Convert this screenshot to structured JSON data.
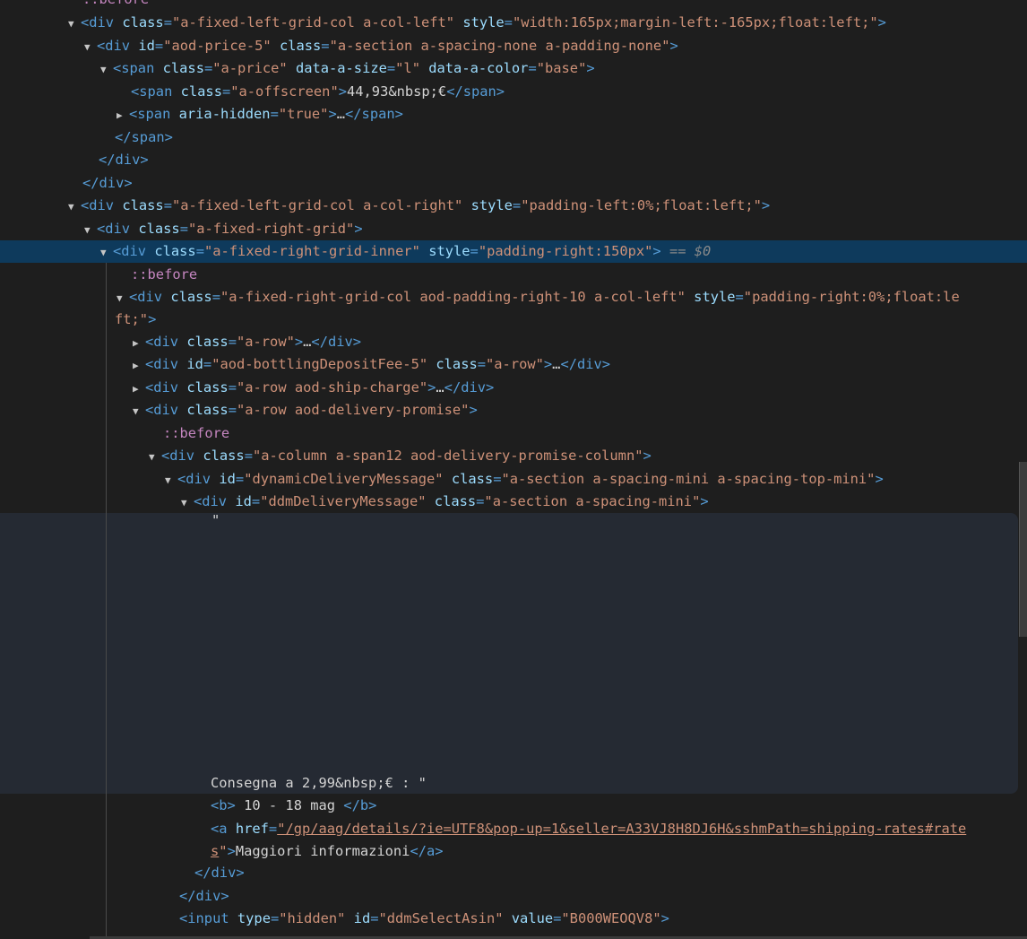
{
  "lines": [
    {
      "pseudo": "::before",
      "text_only": true
    },
    {
      "tag_open": "<div",
      "attrs": [
        {
          "n": "class",
          "v": "\"a-fixed-left-grid-col a-col-left\""
        },
        {
          "n": "style",
          "v": "\"width:165px;margin-left:-165px;float:left;\""
        }
      ],
      "close": ">"
    },
    {
      "tag_open": "<div",
      "attrs": [
        {
          "n": "id",
          "v": "\"aod-price-5\""
        },
        {
          "n": "class",
          "v": "\"a-section a-spacing-none a-padding-none\""
        }
      ],
      "close": ">"
    },
    {
      "tag_open": "<span",
      "attrs": [
        {
          "n": "class",
          "v": "\"a-price\""
        },
        {
          "n": "data-a-size",
          "v": "\"l\""
        },
        {
          "n": "data-a-color",
          "v": "\"base\""
        }
      ],
      "close": ">"
    },
    {
      "tag_open": "<span",
      "attrs": [
        {
          "n": "class",
          "v": "\"a-offscreen\""
        }
      ],
      "close": ">",
      "text": "44,93&nbsp;€",
      "end": "</span>"
    },
    {
      "tag_open": "<span",
      "attrs": [
        {
          "n": "aria-hidden",
          "v": "\"true\""
        }
      ],
      "close": ">",
      "ellipsis": "…",
      "end": "</span>"
    },
    {
      "end_only": "</span>"
    },
    {
      "end_only": "</div>"
    },
    {
      "end_only": "</div>"
    },
    {
      "tag_open": "<div",
      "attrs": [
        {
          "n": "class",
          "v": "\"a-fixed-left-grid-col a-col-right\""
        },
        {
          "n": "style",
          "v": "\"padding-left:0%;float:left;\""
        }
      ],
      "close": ">"
    },
    {
      "tag_open": "<div",
      "attrs": [
        {
          "n": "class",
          "v": "\"a-fixed-right-grid\""
        }
      ],
      "close": ">"
    },
    {
      "tag_open": "<div",
      "attrs": [
        {
          "n": "class",
          "v": "\"a-fixed-right-grid-inner\""
        },
        {
          "n": "style",
          "v": "\"padding-right:150px\""
        }
      ],
      "close": ">",
      "selected_marker": "== $0"
    },
    {
      "pseudo": "::before"
    },
    {
      "tag_open": "<div",
      "attrs": [
        {
          "n": "class",
          "v": "\"a-fixed-right-grid-col aod-padding-right-10 a-col-left\""
        },
        {
          "n": "style",
          "v": "\"padding-right:0%;float:le"
        }
      ]
    },
    {
      "wrap_text": "ft;\"",
      "close": ">"
    },
    {
      "tag_open": "<div",
      "attrs": [
        {
          "n": "class",
          "v": "\"a-row\""
        }
      ],
      "close": ">",
      "ellipsis": "…",
      "end": "</div>"
    },
    {
      "tag_open": "<div",
      "attrs": [
        {
          "n": "id",
          "v": "\"aod-bottlingDepositFee-5\""
        },
        {
          "n": "class",
          "v": "\"a-row\""
        }
      ],
      "close": ">",
      "ellipsis": "…",
      "end": "</div>"
    },
    {
      "tag_open": "<div",
      "attrs": [
        {
          "n": "class",
          "v": "\"a-row aod-ship-charge\""
        }
      ],
      "close": ">",
      "ellipsis": "…",
      "end": "</div>"
    },
    {
      "tag_open": "<div",
      "attrs": [
        {
          "n": "class",
          "v": "\"a-row aod-delivery-promise\""
        }
      ],
      "close": ">"
    },
    {
      "pseudo": "::before"
    },
    {
      "tag_open": "<div",
      "attrs": [
        {
          "n": "class",
          "v": "\"a-column a-span12 aod-delivery-promise-column\""
        }
      ],
      "close": ">"
    },
    {
      "tag_open": "<div",
      "attrs": [
        {
          "n": "id",
          "v": "\"dynamicDeliveryMessage\""
        },
        {
          "n": "class",
          "v": "\"a-section a-spacing-mini a-spacing-top-mini\""
        }
      ],
      "close": ">"
    },
    {
      "tag_open": "<div",
      "attrs": [
        {
          "n": "id",
          "v": "\"ddmDeliveryMessage\""
        },
        {
          "n": "class",
          "v": "\"a-section a-spacing-mini\""
        }
      ],
      "close": ">"
    },
    {
      "plain": "\""
    },
    {
      "plain": "Consegna a 2,99&nbsp;€ : \""
    },
    {
      "tag_open": "<b",
      "close": ">",
      "text": " 10 - 18 mag ",
      "end": "</b>"
    },
    {
      "tag_open": "<a",
      "attrs": [
        {
          "n": "href",
          "v": "\"/gp/aag/details/?ie=UTF8&pop-up=1&seller=A33VJ8H8DJ6H&sshmPath=shipping-rates#rate",
          "link": true
        }
      ]
    },
    {
      "wrap_link": "s",
      "wrap_q": "\"",
      "close": ">",
      "text": "Maggiori informazioni",
      "end": "</a>"
    },
    {
      "end_only": "</div>"
    },
    {
      "end_only": "</div>"
    },
    {
      "tag_open": "<input",
      "attrs": [
        {
          "n": "type",
          "v": "\"hidden\""
        },
        {
          "n": "id",
          "v": "\"ddmSelectAsin\""
        },
        {
          "n": "value",
          "v": "\"B000WEOQV8\""
        }
      ],
      "close": ">"
    }
  ]
}
